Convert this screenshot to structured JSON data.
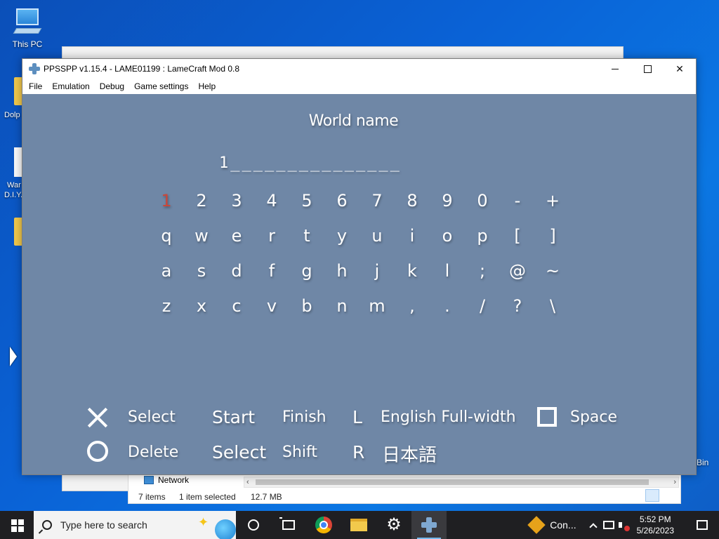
{
  "desktop": {
    "this_pc_label": "This PC",
    "left_fragments": [
      "Dolp",
      "War",
      "D.I.Y."
    ],
    "bin_fragment": "Bin"
  },
  "explorer": {
    "nav_item": "Network",
    "status": {
      "items": "7 items",
      "selected": "1 item selected",
      "size": "12.7 MB"
    }
  },
  "window": {
    "title": "PPSSPP v1.15.4 - LAME01199 : LameCraft Mod 0.8",
    "menu": [
      "File",
      "Emulation",
      "Debug",
      "Game settings",
      "Help"
    ]
  },
  "game": {
    "heading": "World name",
    "name_field": "1_______________",
    "keyboard": [
      [
        "1",
        "2",
        "3",
        "4",
        "5",
        "6",
        "7",
        "8",
        "9",
        "0",
        "-",
        "+"
      ],
      [
        "q",
        "w",
        "e",
        "r",
        "t",
        "y",
        "u",
        "i",
        "o",
        "p",
        "[",
        "]"
      ],
      [
        "a",
        "s",
        "d",
        "f",
        "g",
        "h",
        "j",
        "k",
        "l",
        ";",
        "@",
        "~"
      ],
      [
        "z",
        "x",
        "c",
        "v",
        "b",
        "n",
        "m",
        ",",
        ".",
        "/",
        "?",
        "\\"
      ]
    ],
    "selected_key": "1",
    "controls": {
      "cross_label": "Select",
      "circle_label": "Delete",
      "start_button": "Start",
      "start_action": "Finish",
      "select_button": "Select",
      "select_action": "Shift",
      "l_button": "L",
      "l_action": "English Full-width",
      "r_button": "R",
      "r_action": "日本語",
      "square_label": "Space"
    }
  },
  "taskbar": {
    "search_placeholder": "Type here to search",
    "tray_app_label": "Con...",
    "time": "5:52 PM",
    "date": "5/26/2023"
  },
  "colors": {
    "game_bg": "#6f87a6",
    "selected_key": "#c9473a",
    "taskbar_bg": "#1f1f22"
  }
}
